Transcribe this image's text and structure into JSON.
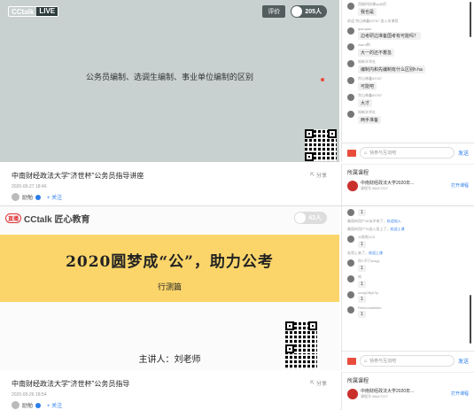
{
  "panel1": {
    "brand": {
      "cc": "CCtalk",
      "live": "LIVE"
    },
    "rate_label": "评价",
    "viewer_count": "205人",
    "slide_text": "公务员编制、选调生编制、事业单位编制的区别",
    "course_title": "中南财经政法大学“济世杯”公务员指导讲座",
    "date": "2020-05-27 18:46",
    "teacher_name": "励勉",
    "follow_label": "+ 关注",
    "share_label": "分享",
    "chat": [
      {
        "type": "msg",
        "name": "西柚科技康sy@佰",
        "text": "我也是"
      },
      {
        "type": "sys",
        "text": "欢迎 宗山林鑫93767 加入本课程"
      },
      {
        "type": "msg",
        "name": "qianqian",
        "text": "边考研边准备国考有可能吗？"
      },
      {
        "type": "msg",
        "name": "warm鸭",
        "text": "大一的还不着急"
      },
      {
        "type": "msg",
        "name": "知新学术社",
        "text": "编制内和先编制有什么区别h ha"
      },
      {
        "type": "msg",
        "name": "宗山林鑫93767",
        "text": "可能吧"
      },
      {
        "type": "msg",
        "name": "宗山林鑫93767",
        "text": "大才"
      },
      {
        "type": "msg",
        "name": "知新学术社",
        "text": "两手准备"
      }
    ],
    "input_placeholder": "快参与互动吧",
    "send_label": "发送",
    "related": {
      "heading": "所属课程",
      "course": "中南财经政法大学2020年...",
      "course_id": "课程号 98417227",
      "open_label": "打开课程"
    }
  },
  "panel2": {
    "brand_text": "CCtalk 匠心教育",
    "brand_badge": "直播",
    "viewer_count": "43人",
    "slogan": "2020圆梦成“公”，助力公考",
    "subject": "行测篇",
    "presenter": "主讲人：刘老师",
    "course_title": "中南财经政法大学“济世杯”公务员指导",
    "date": "2020-05-26 18:54",
    "teacher_name": "励勉",
    "follow_label": "+ 关注",
    "share_label": "分享",
    "chat": [
      {
        "type": "msg",
        "name": "",
        "text": "1"
      },
      {
        "type": "sys",
        "text": "美丽的用户JK似乎来了，",
        "hl": "欢迎加入"
      },
      {
        "type": "sys",
        "text": "美丽的用户Tk加入班上了，",
        "hl": "欢迎上课"
      },
      {
        "type": "msg",
        "name": "11啦啦123",
        "text": "1"
      },
      {
        "type": "sys",
        "text": "宏哥上来了，",
        "hl": "欢迎上课"
      },
      {
        "type": "msg",
        "name": "你C不只mayy",
        "text": "1"
      },
      {
        "type": "msg",
        "name": "哈",
        "text": "1"
      },
      {
        "type": "msg",
        "name": "uxdgOffyk7ly",
        "text": "1"
      },
      {
        "type": "msg",
        "name": "Rebeccahhkkh",
        "text": "1"
      }
    ],
    "input_placeholder": "快参与互动吧",
    "send_label": "发送",
    "related": {
      "heading": "所属课程",
      "course": "中南财经政法大学2020年...",
      "course_id": "课程号 98417227",
      "open_label": "打开课程"
    }
  }
}
